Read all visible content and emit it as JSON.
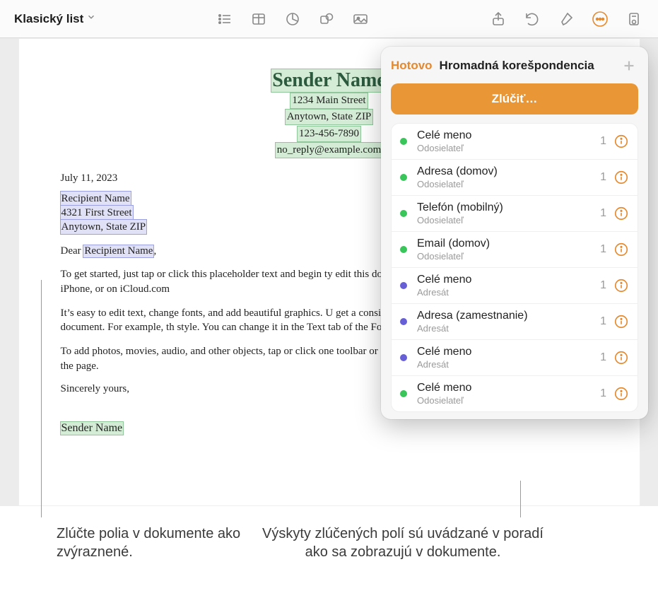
{
  "toolbar": {
    "doc_title": "Klasický list"
  },
  "panel": {
    "done": "Hotovo",
    "title": "Hromadná korešpondencia",
    "merge": "Zlúčiť…",
    "fields": [
      {
        "name": "Celé meno",
        "sub": "Odosielateľ",
        "count": "1",
        "color": "green"
      },
      {
        "name": "Adresa (domov)",
        "sub": "Odosielateľ",
        "count": "1",
        "color": "green"
      },
      {
        "name": "Telefón (mobilný)",
        "sub": "Odosielateľ",
        "count": "1",
        "color": "green"
      },
      {
        "name": "Email (domov)",
        "sub": "Odosielateľ",
        "count": "1",
        "color": "green"
      },
      {
        "name": "Celé meno",
        "sub": "Adresát",
        "count": "1",
        "color": "purple"
      },
      {
        "name": "Adresa (zamestnanie)",
        "sub": "Adresát",
        "count": "1",
        "color": "purple"
      },
      {
        "name": "Celé meno",
        "sub": "Adresát",
        "count": "1",
        "color": "purple"
      },
      {
        "name": "Celé meno",
        "sub": "Odosielateľ",
        "count": "1",
        "color": "green"
      }
    ]
  },
  "doc": {
    "sender_name": "Sender Name",
    "sender_addr1": "1234 Main Street",
    "sender_addr2": "Anytown, State ZIP",
    "sender_phone": "123-456-7890",
    "sender_email": "no_reply@example.com",
    "date": "July 11, 2023",
    "recipient_name": "Recipient Name",
    "recipient_addr1": "4321 First Street",
    "recipient_addr2": "Anytown, State ZIP",
    "dear_pre": "Dear ",
    "dear_name": "Recipient Name",
    "dear_post": ",",
    "p1": "To get started, just tap or click this placeholder text and begin ty edit this document on your Mac, iPad, iPhone, or on iCloud.com",
    "p2": "It’s easy to edit text, change fonts, and add beautiful graphics. U get a consistent look throughout your document. For example, th style. You can change it in the Text tab of the Format controls.",
    "p3": "To add photos, movies, audio, and other objects, tap or click one toolbar or drag and drop the objects onto the page.",
    "closing": "Sincerely yours,",
    "signature": "Sender Name"
  },
  "captions": {
    "left": "Zlúčte polia v dokumente ako zvýraznené.",
    "right": "Výskyty zlúčených polí sú uvádzané v poradí ako sa zobrazujú v dokumente."
  }
}
